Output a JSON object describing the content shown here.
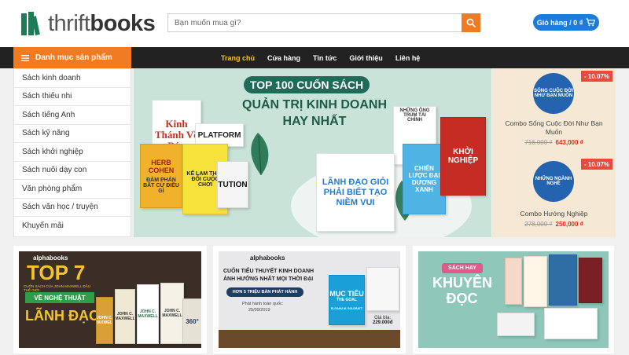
{
  "header": {
    "logo": {
      "part1": "thrift",
      "part2": "books"
    },
    "search": {
      "placeholder": "Bạn muốn mua gì?"
    },
    "cart": {
      "label": "Giỏ hàng / 0 ₫"
    }
  },
  "nav": {
    "categories_label": "Danh mục sản phẩm",
    "links": [
      "Trang chủ",
      "Cửa hàng",
      "Tin tức",
      "Giới thiệu",
      "Liên hệ"
    ]
  },
  "sidebar": {
    "items": [
      "Sách kinh doanh",
      "Sách thiếu nhi",
      "Sách tiếng Anh",
      "Sách kỹ năng",
      "Sách khởi nghiệp",
      "Sách nuôi dạy con",
      "Văn phòng phẩm",
      "Sách văn học / truyện",
      "Khuyến mãi"
    ]
  },
  "hero": {
    "title": "TOP 100 CUỐN SÁCH",
    "subtitle1": "QUẢN TRỊ KINH DOANH",
    "subtitle2": "HAY NHẤT",
    "books": [
      "Kinh Thánh Về Bán",
      "PLATFORM",
      "HERB COHEN",
      "ĐÀM PHÁN BẤT CỨ ĐIỀU GÌ",
      "KẾ LAM THAY ĐỔI CUỘC CHƠI",
      "TUTION",
      "NHỮNG ÔNG TRÙM TÀI CHÍNH",
      "LÃNH ĐẠO GIỎI PHẢI BIẾT TẠO NIỀM VUI",
      "CHIẾN LƯỢC ĐẠI DƯƠNG XANH",
      "KHỞI NGHIỆP"
    ]
  },
  "promo": {
    "items": [
      {
        "badge": "- 10.07%",
        "thumb": "SỐNG CUỘC ĐỜI NHƯ BẠN MUỐN",
        "name": "Combo Sống Cuộc Đời Như Bạn Muốn",
        "old_price": "716.000 ₫",
        "new_price": "643,000 ₫"
      },
      {
        "badge": "- 10.07%",
        "thumb": "NHỮNG NGÀNH NGHỀ",
        "name": "Combo Hướng Nghiệp",
        "old_price": "278,000 ₫",
        "new_price": "250,000 ₫"
      }
    ]
  },
  "banners": {
    "b1": {
      "brand": "alphabooks",
      "title": "TOP 7",
      "small": "CUỐN SÁCH CỦA JOHN MAXWELL ĐẦU THẾ GIỚI",
      "ribbon": "VỀ NGHỆ THUẬT",
      "title2": "LÃNH ĐẠO",
      "books": [
        "JOHN C. MAXWELL",
        "JOHN C. MAXWELL",
        "JOHN C. MAXWELL",
        "JOHN C. MAXWELL",
        "360°"
      ]
    },
    "b2": {
      "brand": "alphabooks",
      "line1": "CUỐN TIỂU THUYẾT KINH DOANH",
      "line2": "ẢNH HƯỞNG NHẤT MỌI THỜI ĐẠI",
      "pill": "HƠN 5 TRIỆU BẢN PHÁT HÀNH",
      "date_label": "Phát hành toàn quốc:",
      "date": "25/09/2019",
      "book_title": "MỤC TIÊU",
      "book_sub": "THE GOAL",
      "author": "ELIYAHU M. GOLDRATT",
      "price_label": "Giá bìa:",
      "price": "229.000đ"
    },
    "b3": {
      "tag": "SÁCH HAY",
      "title1": "KHUYÊN",
      "title2": "ĐỌC"
    }
  }
}
